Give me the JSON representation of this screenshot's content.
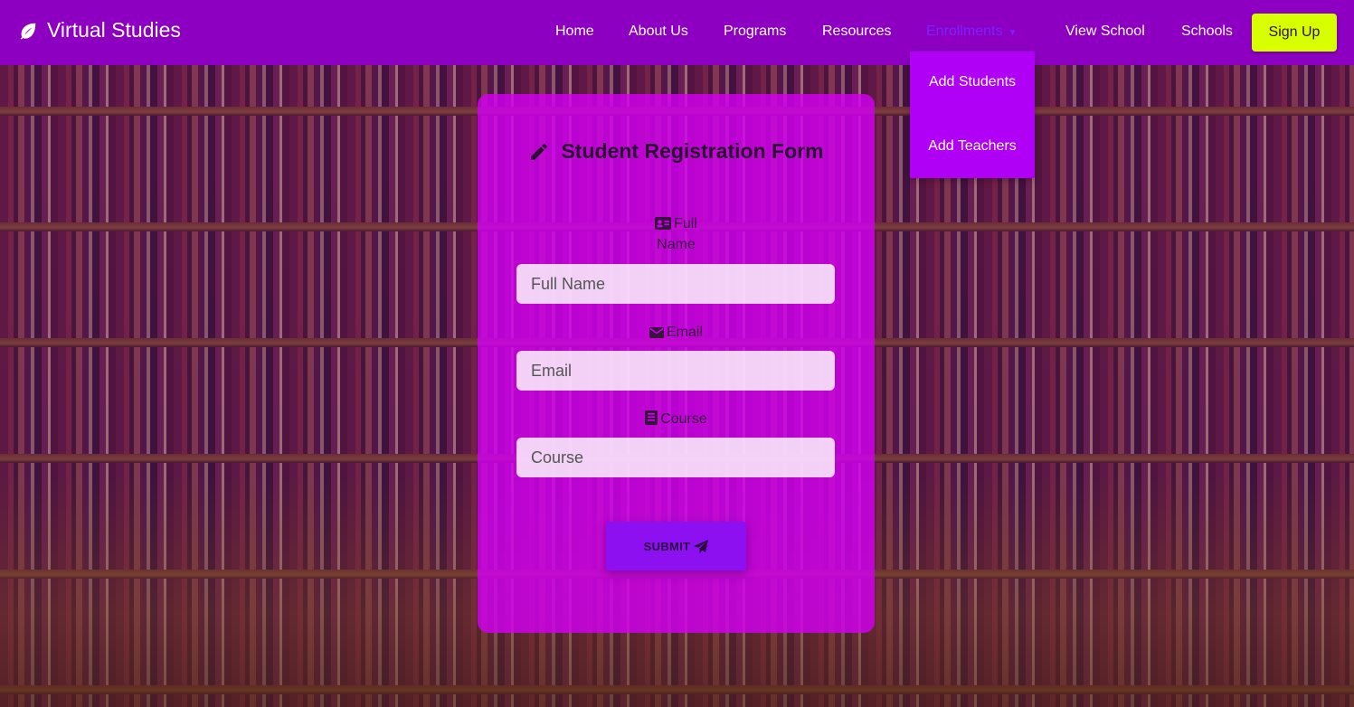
{
  "brand": {
    "name": "Virtual Studies",
    "icon": "leaf-icon"
  },
  "nav": {
    "items": [
      {
        "label": "Home"
      },
      {
        "label": "About Us"
      },
      {
        "label": "Programs"
      },
      {
        "label": "Resources"
      },
      {
        "label": "Enrollments",
        "state": "open"
      },
      {
        "label": "View School"
      },
      {
        "label": "Schools"
      }
    ],
    "signup_label": "Sign Up"
  },
  "dropdown": {
    "items": [
      {
        "label": "Add Students"
      },
      {
        "label": "Add Teachers"
      }
    ]
  },
  "form": {
    "title": "Student Registration Form",
    "title_icon": "pencil-icon",
    "fields": [
      {
        "label": "Full Name",
        "placeholder": "Full Name",
        "icon": "id-card-icon"
      },
      {
        "label": "Email",
        "placeholder": "Email",
        "icon": "envelope-icon"
      },
      {
        "label": "Course",
        "placeholder": "Course",
        "icon": "book-icon"
      }
    ],
    "submit_label": "SUBMIT",
    "submit_icon": "paper-plane-icon"
  },
  "colors": {
    "navbar": "#8d00c2",
    "card": "#d200f0",
    "signup": "#d7ff00",
    "dropdown": "#b000f5",
    "submit": "#8c10f0"
  }
}
